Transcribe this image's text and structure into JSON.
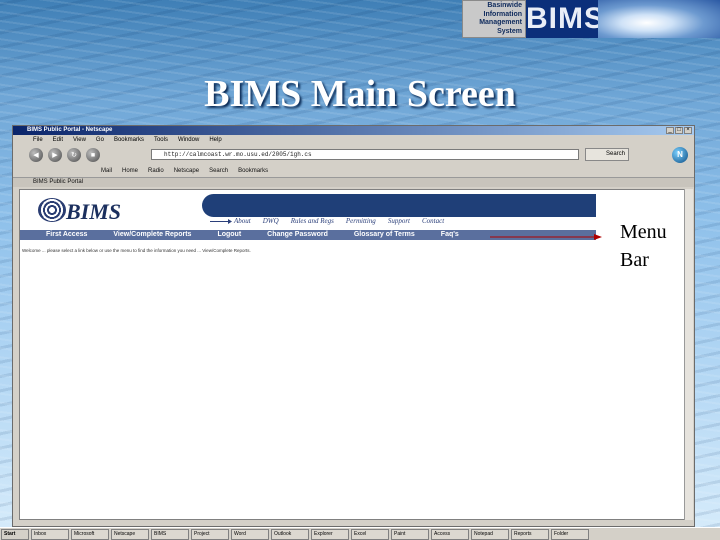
{
  "logo": {
    "line1": "Basinwide",
    "line2": "Information",
    "line3": "Management",
    "line4": "System",
    "acronym": "BIMS"
  },
  "slide_title": "BIMS Main Screen",
  "browser": {
    "title": "BIMS Public Portal - Netscape",
    "menu": [
      "File",
      "Edit",
      "View",
      "Go",
      "Bookmarks",
      "Tools",
      "Window",
      "Help"
    ],
    "url": "http://calmcoast.wr.mo.usu.ed/2005/1gh.cs",
    "search_label": "Search",
    "personal": [
      "Mail",
      "Home",
      "Radio",
      "Netscape",
      "Search",
      "Bookmarks"
    ],
    "tab": "BIMS Public Portal",
    "site_logo": "BIMS",
    "menu_links": [
      "About",
      "DWQ",
      "Rules and Regs",
      "Permitting",
      "Support",
      "Contact"
    ],
    "nav_links": [
      "First Access",
      "View/Complete Reports",
      "Logout",
      "Change Password",
      "Glossary of Terms",
      "Faq's"
    ],
    "welcome": "Welcome ... please select a link below or use the menu to find the information you need ... View/Complete Reports."
  },
  "annotation": {
    "line1": "Menu",
    "line2": "Bar"
  },
  "taskbar": {
    "start": "Start",
    "items": [
      "Inbox",
      "Microsoft",
      "Netscape",
      "BIMS",
      "Project",
      "Word",
      "Outlook",
      "Explorer",
      "Excel",
      "Paint",
      "Access",
      "Notepad",
      "Reports",
      "Folder"
    ]
  },
  "colors": {
    "header_band": "#1f3f78",
    "nav_row": "#5a6f9e",
    "callout_arrow": "#b00000"
  }
}
